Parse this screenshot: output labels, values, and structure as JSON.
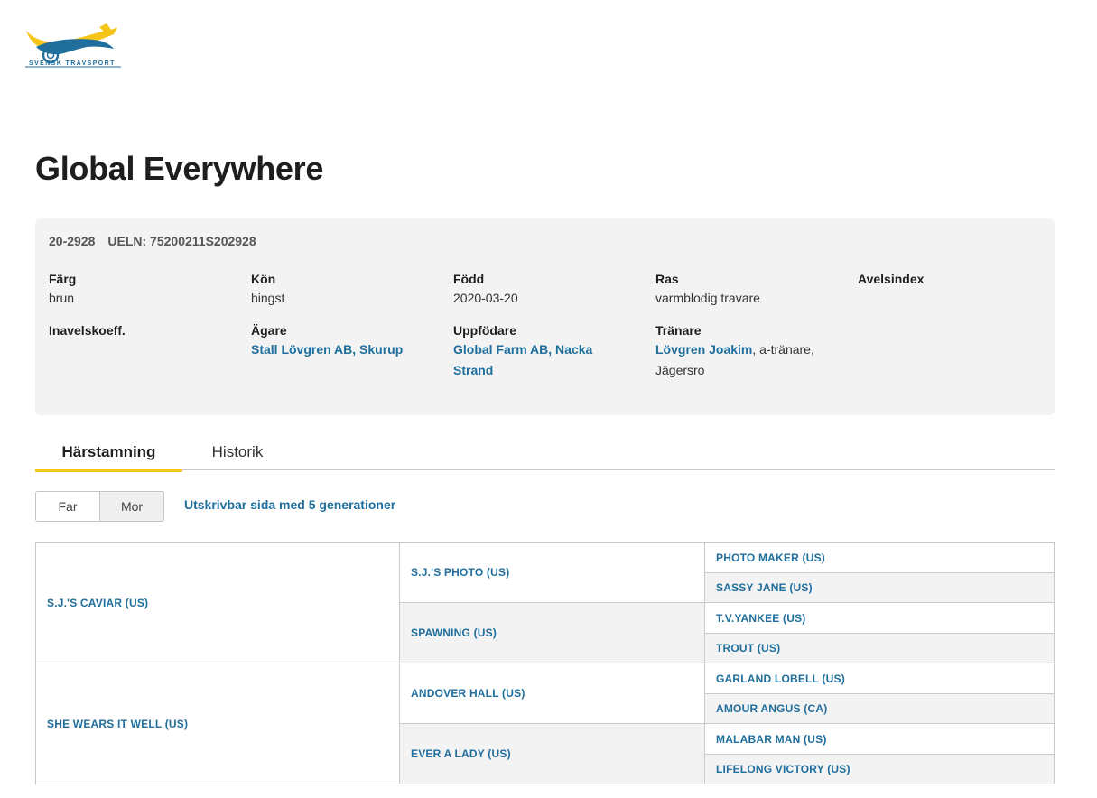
{
  "brand": {
    "name": "SVENSK TRAVSPORT"
  },
  "horse": {
    "name": "Global Everywhere",
    "reg_number": "20-2928",
    "ueln": "UELN: 75200211S202928"
  },
  "details": {
    "color_label": "Färg",
    "color_value": "brun",
    "sex_label": "Kön",
    "sex_value": "hingst",
    "born_label": "Född",
    "born_value": "2020-03-20",
    "breed_label": "Ras",
    "breed_value": "varmblodig travare",
    "breeding_index_label": "Avelsindex",
    "inbreeding_label": "Inavelskoeff.",
    "owner_label": "Ägare",
    "owner_value": "Stall Lövgren AB, Skurup",
    "breeder_label": "Uppfödare",
    "breeder_value_line1": "Global Farm AB, Nacka",
    "breeder_value_line2": "Strand",
    "trainer_label": "Tränare",
    "trainer_name": "Lövgren Joakim",
    "trainer_rest_line1": ", a-tränare,",
    "trainer_rest_line2": "Jägersro"
  },
  "tabs": [
    {
      "label": "Härstamning",
      "active": true
    },
    {
      "label": "Historik",
      "active": false
    }
  ],
  "toggle": {
    "far": "Far",
    "mor": "Mor",
    "selected": "Mor"
  },
  "print_link": "Utskrivbar sida med 5 generationer",
  "pedigree": {
    "sire": "S.J.'S CAVIAR (US)",
    "dam": "SHE WEARS IT WELL (US)",
    "gen2": [
      "S.J.'S PHOTO (US)",
      "SPAWNING (US)",
      "ANDOVER HALL (US)",
      "EVER A LADY (US)"
    ],
    "gen3": [
      "PHOTO MAKER (US)",
      "SASSY JANE (US)",
      "T.V.YANKEE (US)",
      "TROUT (US)",
      "GARLAND LOBELL (US)",
      "AMOUR ANGUS (CA)",
      "MALABAR MAN (US)",
      "LIFELONG VICTORY (US)"
    ]
  },
  "colors": {
    "link": "#1f6e9c",
    "accent": "#f5c518",
    "panel": "#f3f3f3"
  }
}
